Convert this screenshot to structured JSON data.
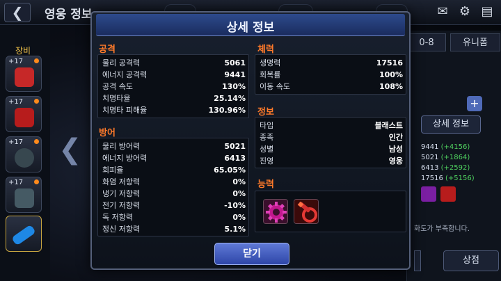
{
  "background": {
    "screen_title": "영웅 정보",
    "back_icon": "back-arrow-icon",
    "top_icons": [
      "mail-icon",
      "gear-icon",
      "chat-icon"
    ],
    "equipment_label": "장비",
    "equip_slots": [
      {
        "level": "+17",
        "art_color": "#c62828"
      },
      {
        "level": "+17",
        "art_color": "#b71c1c"
      },
      {
        "level": "+17",
        "art_color": "#37474f"
      },
      {
        "level": "+17",
        "art_color": "#455a64"
      },
      {
        "level": "",
        "art_color": "#1e88e5"
      }
    ],
    "tab_partial": "0-8",
    "tab_unique": "유니폼",
    "detail_button": "상세 정보",
    "side_stats": [
      {
        "base": "9441",
        "bonus": "(+4156)"
      },
      {
        "base": "5021",
        "bonus": "(+1864)"
      },
      {
        "base": "6413",
        "bonus": "(+2592)"
      },
      {
        "base": "17516",
        "bonus": "(+5156)"
      }
    ],
    "warning_text": "화도가 부족합니다.",
    "shop_button": "상점"
  },
  "modal": {
    "title": "상세 정보",
    "attack": {
      "heading": "공격",
      "rows": [
        {
          "label": "물리 공격력",
          "value": "5061"
        },
        {
          "label": "에너지 공격력",
          "value": "9441"
        },
        {
          "label": "공격 속도",
          "value": "130%"
        },
        {
          "label": "치명타율",
          "value": "25.14%"
        },
        {
          "label": "치명타 피해율",
          "value": "130.96%"
        }
      ]
    },
    "defense": {
      "heading": "방어",
      "rows": [
        {
          "label": "물리 방어력",
          "value": "5021"
        },
        {
          "label": "에너지 방어력",
          "value": "6413"
        },
        {
          "label": "회피율",
          "value": "65.05%"
        },
        {
          "label": "화염 저항력",
          "value": "0%"
        },
        {
          "label": "냉기 저항력",
          "value": "0%"
        },
        {
          "label": "전기 저항력",
          "value": "-10%"
        },
        {
          "label": "독 저항력",
          "value": "0%"
        },
        {
          "label": "정신 저항력",
          "value": "5.1%"
        }
      ]
    },
    "health": {
      "heading": "체력",
      "rows": [
        {
          "label": "생명력",
          "value": "17516"
        },
        {
          "label": "회복률",
          "value": "100%"
        },
        {
          "label": "이동 속도",
          "value": "108%"
        }
      ]
    },
    "info": {
      "heading": "정보",
      "rows": [
        {
          "label": "타입",
          "value": "블래스트"
        },
        {
          "label": "종족",
          "value": "인간"
        },
        {
          "label": "성별",
          "value": "남성"
        },
        {
          "label": "진영",
          "value": "영웅"
        }
      ]
    },
    "ability": {
      "heading": "능력",
      "icons": [
        "gear-ability-icon",
        "blade-ability-icon"
      ]
    },
    "close_button": "닫기"
  },
  "colors": {
    "section_heading": "#ff7a2a",
    "header_blue": "#2d4a8c",
    "button_blue": "#4660c4",
    "bonus_green": "#4fd25f"
  }
}
